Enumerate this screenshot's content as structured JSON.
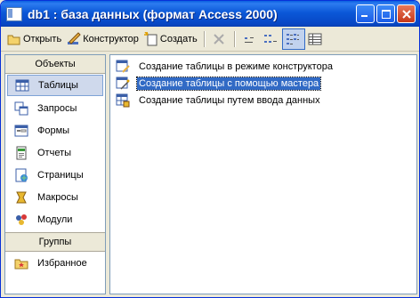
{
  "window": {
    "title": "db1 : база данных (формат Access 2000)"
  },
  "toolbar": {
    "open_label": "Открыть",
    "designer_label": "Конструктор",
    "create_label": "Создать"
  },
  "sidebar": {
    "objects_header": "Объекты",
    "items": [
      {
        "label": "Таблицы",
        "icon": "table-icon"
      },
      {
        "label": "Запросы",
        "icon": "query-icon"
      },
      {
        "label": "Формы",
        "icon": "form-icon"
      },
      {
        "label": "Отчеты",
        "icon": "report-icon"
      },
      {
        "label": "Страницы",
        "icon": "page-icon"
      },
      {
        "label": "Макросы",
        "icon": "macro-icon"
      },
      {
        "label": "Модули",
        "icon": "module-icon"
      }
    ],
    "groups_header": "Группы",
    "groups": [
      {
        "label": "Избранное",
        "icon": "favorites-icon"
      }
    ]
  },
  "content": {
    "items": [
      {
        "label": "Создание таблицы в режиме конструктора"
      },
      {
        "label": "Создание таблицы с помощью мастера"
      },
      {
        "label": "Создание таблицы путем ввода данных"
      }
    ]
  },
  "colors": {
    "titlebar": "#0a58d8",
    "selection": "#316ac5"
  }
}
